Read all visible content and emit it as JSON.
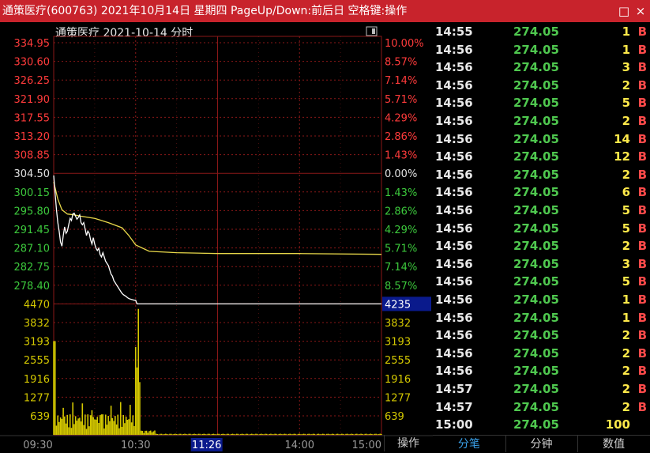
{
  "window": {
    "title": "通策医疗(600763) 2021年10月14日 星期四 PageUp/Down:前后日 空格键:操作",
    "restore_glyph": "□",
    "close_glyph": "×"
  },
  "chart": {
    "header": "通策医疗   2021-10-14 分时",
    "prev_close": 304.5,
    "price_labels": [
      "334.95",
      "330.60",
      "326.25",
      "321.90",
      "317.55",
      "313.20",
      "308.85",
      "304.50",
      "300.15",
      "295.80",
      "291.45",
      "287.10",
      "282.75",
      "278.40"
    ],
    "pct_labels": [
      "10.00%",
      "8.57%",
      "7.14%",
      "5.71%",
      "4.29%",
      "2.86%",
      "1.43%",
      "0.00%",
      "1.43%",
      "2.86%",
      "4.29%",
      "5.71%",
      "7.14%",
      "8.57%"
    ],
    "volume_labels_left": [
      "4470",
      "3832",
      "3193",
      "2555",
      "1916",
      "1277",
      "639"
    ],
    "volume_labels_right": [
      "4235",
      "3832",
      "3193",
      "2555",
      "1916",
      "1277",
      "639"
    ],
    "time_labels": [
      "09:30",
      "10:30",
      "11:26",
      "14:00",
      "15:00"
    ],
    "operate_label": "操作",
    "colors": {
      "up": "#ff3b3b",
      "down": "#3cc83c",
      "flat": "#e0e0e0",
      "price_line": "#ffffff",
      "avg_line": "#e8d84a",
      "volume": "#d4c800",
      "grid": "#8a1818",
      "cursor_box": "#0a1a8c"
    }
  },
  "chart_data": {
    "type": "line",
    "title": "通策医疗 2021-10-14 分时",
    "ylim": [
      278.4,
      334.95
    ],
    "series": [
      {
        "name": "price",
        "x": [
          0,
          1,
          2,
          3,
          4,
          5,
          6,
          7,
          8,
          9,
          10,
          11,
          12,
          13,
          14,
          15,
          16,
          17,
          18,
          19,
          20,
          21,
          22,
          23,
          24,
          25,
          26,
          27,
          28,
          29,
          30,
          31,
          32,
          33,
          34,
          35,
          36,
          37,
          38,
          39,
          40,
          41,
          42,
          43,
          44,
          45,
          46,
          47,
          48,
          49,
          50,
          51,
          52,
          53,
          54,
          55,
          56,
          57,
          58,
          59,
          60,
          61,
          62,
          63,
          240
        ],
        "values": [
          304.0,
          300.0,
          296.0,
          293.0,
          291.0,
          288.5,
          287.5,
          290.0,
          292.0,
          290.5,
          291.0,
          292.5,
          294.0,
          293.5,
          295.0,
          295.2,
          294.5,
          293.8,
          294.2,
          294.8,
          293.0,
          292.5,
          293.0,
          291.5,
          290.0,
          291.0,
          290.5,
          289.0,
          288.0,
          289.5,
          288.0,
          287.0,
          286.5,
          287.0,
          285.5,
          285.0,
          286.0,
          285.0,
          284.0,
          283.5,
          283.0,
          282.0,
          281.0,
          280.5,
          279.5,
          279.0,
          278.5,
          278.0,
          277.5,
          277.0,
          276.5,
          276.2,
          276.0,
          275.8,
          275.5,
          275.3,
          275.2,
          275.1,
          275.0,
          274.9,
          274.9,
          274.05,
          274.05,
          274.05,
          274.05
        ]
      },
      {
        "name": "average",
        "x": [
          0,
          3,
          6,
          10,
          15,
          20,
          30,
          40,
          50,
          55,
          60,
          70,
          90,
          120,
          180,
          240
        ],
        "values": [
          302.5,
          298.5,
          296.0,
          295.0,
          294.8,
          294.5,
          294.0,
          293.0,
          291.8,
          290.0,
          287.8,
          286.3,
          286.0,
          285.8,
          285.8,
          285.6
        ]
      }
    ],
    "volume_ylim": [
      0,
      4470
    ]
  },
  "ticks": {
    "rows": [
      {
        "time": "14:55",
        "price": "274.05",
        "vol": "1",
        "bs": "B"
      },
      {
        "time": "14:56",
        "price": "274.05",
        "vol": "1",
        "bs": "B"
      },
      {
        "time": "14:56",
        "price": "274.05",
        "vol": "3",
        "bs": "B"
      },
      {
        "time": "14:56",
        "price": "274.05",
        "vol": "2",
        "bs": "B"
      },
      {
        "time": "14:56",
        "price": "274.05",
        "vol": "5",
        "bs": "B"
      },
      {
        "time": "14:56",
        "price": "274.05",
        "vol": "2",
        "bs": "B"
      },
      {
        "time": "14:56",
        "price": "274.05",
        "vol": "14",
        "bs": "B"
      },
      {
        "time": "14:56",
        "price": "274.05",
        "vol": "12",
        "bs": "B"
      },
      {
        "time": "14:56",
        "price": "274.05",
        "vol": "2",
        "bs": "B"
      },
      {
        "time": "14:56",
        "price": "274.05",
        "vol": "6",
        "bs": "B"
      },
      {
        "time": "14:56",
        "price": "274.05",
        "vol": "5",
        "bs": "B"
      },
      {
        "time": "14:56",
        "price": "274.05",
        "vol": "5",
        "bs": "B"
      },
      {
        "time": "14:56",
        "price": "274.05",
        "vol": "2",
        "bs": "B"
      },
      {
        "time": "14:56",
        "price": "274.05",
        "vol": "3",
        "bs": "B"
      },
      {
        "time": "14:56",
        "price": "274.05",
        "vol": "5",
        "bs": "B"
      },
      {
        "time": "14:56",
        "price": "274.05",
        "vol": "1",
        "bs": "B"
      },
      {
        "time": "14:56",
        "price": "274.05",
        "vol": "1",
        "bs": "B"
      },
      {
        "time": "14:56",
        "price": "274.05",
        "vol": "2",
        "bs": "B"
      },
      {
        "time": "14:56",
        "price": "274.05",
        "vol": "2",
        "bs": "B"
      },
      {
        "time": "14:56",
        "price": "274.05",
        "vol": "2",
        "bs": "B"
      },
      {
        "time": "14:57",
        "price": "274.05",
        "vol": "2",
        "bs": "B"
      },
      {
        "time": "14:57",
        "price": "274.05",
        "vol": "2",
        "bs": "B"
      },
      {
        "time": "15:00",
        "price": "274.05",
        "vol": "100",
        "bs": ""
      }
    ]
  },
  "tabs": [
    {
      "label": "分笔",
      "active": true
    },
    {
      "label": "分钟",
      "active": false
    },
    {
      "label": "数值",
      "active": false
    }
  ]
}
